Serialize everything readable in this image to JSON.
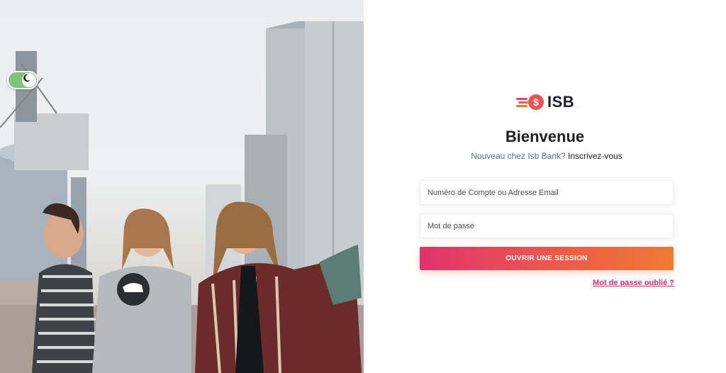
{
  "theme_toggle": {
    "icon": "moon-icon",
    "state": "on"
  },
  "brand": {
    "name": "ISB",
    "accent": "#e8406a",
    "accent_end": "#f07a2f"
  },
  "login": {
    "title": "Bienvenue",
    "subtitle_prefix": "Nouveau chez Isb Bank?",
    "signup_link": "Inscrivez-vous",
    "account_placeholder": "Numéro de Compte ou Adresse Email",
    "password_placeholder": "Mot de passe",
    "submit_label": "OUVRIR UNE SESSION",
    "forgot_link": "Mot de passe oublié ?"
  },
  "colors": {
    "background": "#ffffff",
    "title": "#1b1b22",
    "subtitle": "#5a6f8c",
    "link": "#d62f72",
    "toggle": "#7cc47a"
  }
}
